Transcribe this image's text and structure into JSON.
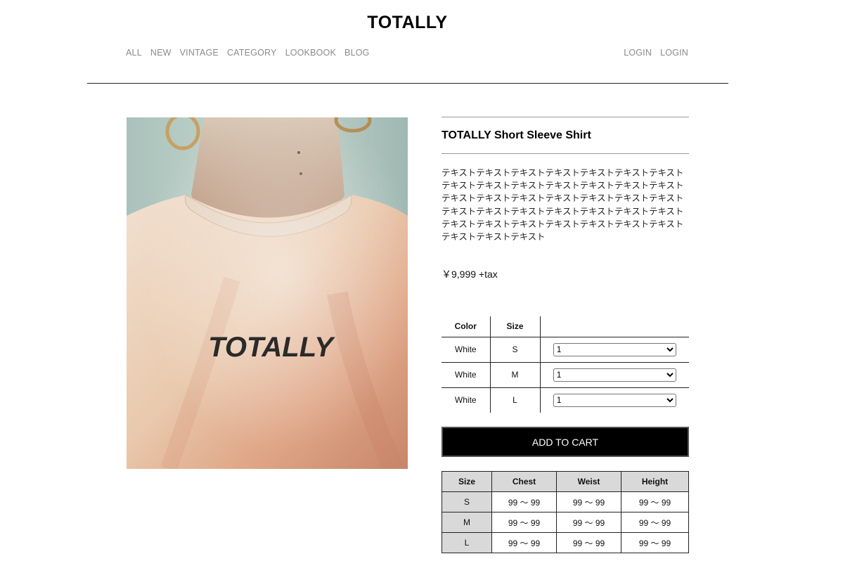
{
  "header": {
    "brand": "TOTALLY",
    "nav_left": [
      "ALL",
      "NEW",
      "VINTAGE",
      "CATEGORY",
      "LOOKBOOK",
      "BLOG"
    ],
    "nav_right": [
      "LOGIN",
      "LOGIN"
    ]
  },
  "product": {
    "image_text": "TOTALLY",
    "title": "TOTALLY Short Sleeve Shirt",
    "description": "テキストテキストテキストテキストテキストテキストテキスト テキストテキストテキストテキストテキストテキストテキスト テキストテキストテキストテキストテキストテキストテキスト テキストテキストテキストテキストテキストテキストテキスト テキストテキストテキストテキストテキストテキストテキスト テキストテキストテキスト",
    "price": "￥9,999 +tax"
  },
  "variants": {
    "headers": [
      "Color",
      "Size",
      ""
    ],
    "rows": [
      {
        "color": "White",
        "size": "S",
        "qty": "1"
      },
      {
        "color": "White",
        "size": "M",
        "qty": "1"
      },
      {
        "color": "White",
        "size": "L",
        "qty": "1"
      }
    ]
  },
  "cart": {
    "add_label": "ADD TO CART"
  },
  "size_chart": {
    "headers": [
      "Size",
      "Chest",
      "Weist",
      "Height"
    ],
    "rows": [
      [
        "S",
        "99 〜 99",
        "99 〜 99",
        "99 〜 99"
      ],
      [
        "M",
        "99 〜 99",
        "99 〜 99",
        "99 〜 99"
      ],
      [
        "L",
        "99 〜 99",
        "99 〜 99",
        "99 〜 99"
      ]
    ]
  },
  "colors": {
    "accent": "#000000",
    "nav_text": "#8a8a8a",
    "table_head_bg": "#d9d9d9"
  }
}
